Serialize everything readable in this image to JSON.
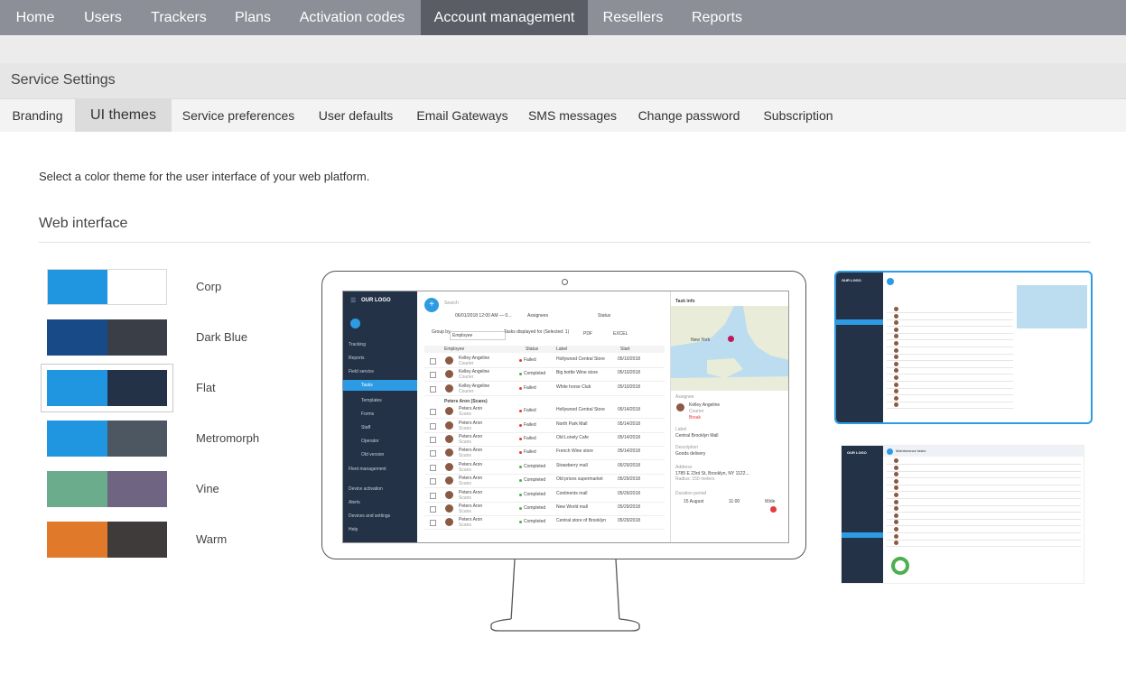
{
  "nav": {
    "items": [
      "Home",
      "Users",
      "Trackers",
      "Plans",
      "Activation codes",
      "Account management",
      "Resellers",
      "Reports"
    ],
    "active_index": 5
  },
  "page": {
    "title": "Service Settings"
  },
  "subtabs": {
    "items": [
      "Branding",
      "UI themes",
      "Service preferences",
      "User defaults",
      "Email Gateways",
      "SMS messages",
      "Change password",
      "Subscription"
    ],
    "active_index": 1
  },
  "content": {
    "intro": "Select a color theme for the user interface of your web platform.",
    "section_title": "Web interface"
  },
  "themes": [
    {
      "name": "Corp",
      "colors": [
        "#2196e0",
        "#ffffff"
      ]
    },
    {
      "name": "Dark Blue",
      "colors": [
        "#174a86",
        "#3a3f47"
      ]
    },
    {
      "name": "Flat",
      "colors": [
        "#2196e0",
        "#233246"
      ],
      "selected": true
    },
    {
      "name": "Metromorph",
      "colors": [
        "#2196e0",
        "#4d5762"
      ]
    },
    {
      "name": "Vine",
      "colors": [
        "#6aac8b",
        "#6f6481"
      ]
    },
    {
      "name": "Warm",
      "colors": [
        "#e07a2a",
        "#403b3b"
      ]
    }
  ],
  "preview": {
    "logo": "OUR LOGO",
    "menu": [
      "Tracking",
      "Reports",
      "Field service",
      "Tasks",
      "Templates",
      "Forms",
      "Staff",
      "Operator",
      "Old version",
      "Fleet management",
      "Device activation",
      "Alerts",
      "Devices and settings",
      "Help"
    ],
    "search_placeholder": "Search",
    "date_range": "06/01/2018 12:00 AM — 0...",
    "assignees": "Assignees",
    "status": "Status",
    "group_by_label": "Group by",
    "group_by_value": "Employee",
    "tasks_info": "Tasks displayed for (Selected: 1)",
    "pdf": "PDF",
    "excel": "EXCEL",
    "columns": [
      "Employee",
      "Status",
      "Label",
      "Start"
    ],
    "group_header": "Peters Aron (Scans)",
    "rows": [
      {
        "name": "Kelley Angeline",
        "sub": "Courier",
        "status": "Failed",
        "label": "Hollywood Central Store",
        "start": "05/10/2018"
      },
      {
        "name": "Kelley Angeline",
        "sub": "Courier",
        "status": "Completed",
        "label": "Big bottle Wine store",
        "start": "05/10/2018"
      },
      {
        "name": "Kelley Angeline",
        "sub": "Courier",
        "status": "Failed",
        "label": "White horse Club",
        "start": "05/10/2018"
      },
      {
        "name": "Peters Aron",
        "sub": "Scans",
        "status": "Failed",
        "label": "Hollywood Central Store",
        "start": "05/14/2018"
      },
      {
        "name": "Peters Aron",
        "sub": "Scans",
        "status": "Failed",
        "label": "North Park Mall",
        "start": "05/14/2018"
      },
      {
        "name": "Peters Aron",
        "sub": "Scans",
        "status": "Failed",
        "label": "Old Lonely Cafe",
        "start": "05/14/2018"
      },
      {
        "name": "Peters Aron",
        "sub": "Scans",
        "status": "Failed",
        "label": "French Wine store",
        "start": "05/14/2018"
      },
      {
        "name": "Peters Aron",
        "sub": "Scans",
        "status": "Completed",
        "label": "Strawberry mall",
        "start": "05/29/2018"
      },
      {
        "name": "Peters Aron",
        "sub": "Scans",
        "status": "Completed",
        "label": "Old prices supermarket",
        "start": "05/29/2018"
      },
      {
        "name": "Peters Aron",
        "sub": "Scans",
        "status": "Completed",
        "label": "Continents mall",
        "start": "05/29/2018"
      },
      {
        "name": "Peters Aron",
        "sub": "Scans",
        "status": "Completed",
        "label": "New World mall",
        "start": "05/29/2018"
      },
      {
        "name": "Peters Aron",
        "sub": "Scans",
        "status": "Completed",
        "label": "Central store of Brooklyn",
        "start": "05/29/2018"
      }
    ],
    "task_info": {
      "title": "Task info",
      "city": "New York",
      "assignee_label": "Assignee",
      "assignee_name": "Kelley Angeline",
      "assignee_role": "Courier",
      "assignee_state": "Break",
      "label_title": "Label",
      "label_value": "Central Brooklyn Mall",
      "desc_title": "Description",
      "desc_value": "Goods delivery",
      "address_title": "Address",
      "address_value": "1785 E 23rd St, Brooklyn, NY 1122...",
      "radius": "Radius: 150 meters",
      "period_title": "Duration period",
      "date": "15 August",
      "time": "11:00",
      "status_word": "Wide"
    },
    "thumb2_title": "Maintenance tasks"
  }
}
